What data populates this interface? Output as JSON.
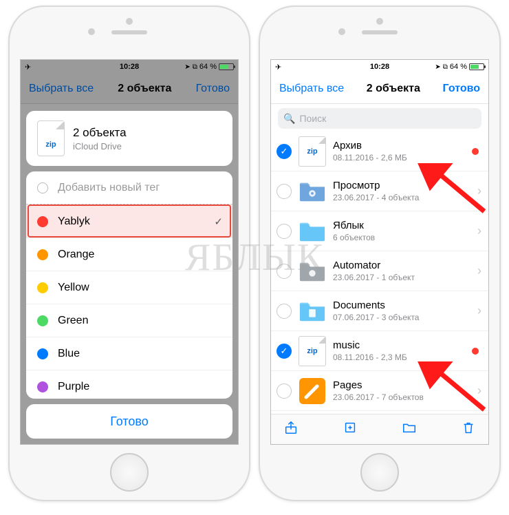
{
  "status": {
    "time": "10:28",
    "battery_text": "64 %"
  },
  "nav": {
    "select_all": "Выбрать все",
    "title": "2 объекта",
    "done": "Готово"
  },
  "sheet": {
    "icon_label": "zip",
    "title": "2 объекта",
    "subtitle": "iCloud Drive",
    "add_tag": "Добавить новый тег",
    "tags": [
      {
        "label": "Yablyk",
        "color": "#ff3b30",
        "selected": true
      },
      {
        "label": "Orange",
        "color": "#ff9500",
        "selected": false
      },
      {
        "label": "Yellow",
        "color": "#ffcc00",
        "selected": false
      },
      {
        "label": "Green",
        "color": "#4cd964",
        "selected": false
      },
      {
        "label": "Blue",
        "color": "#007aff",
        "selected": false
      },
      {
        "label": "Purple",
        "color": "#af52de",
        "selected": false
      }
    ],
    "done": "Готово"
  },
  "search": {
    "placeholder": "Поиск"
  },
  "files": [
    {
      "name": "Архив",
      "sub": "08.11.2016 - 2,6 МБ",
      "kind": "zip",
      "selected": true,
      "tagged": true
    },
    {
      "name": "Просмотр",
      "sub": "23.06.2017 - 4 объекта",
      "kind": "folder",
      "selected": false,
      "tagged": false,
      "color": "#6ea6dd",
      "glyph": "preview"
    },
    {
      "name": "Яблык",
      "sub": "6 объектов",
      "kind": "folder",
      "selected": false,
      "tagged": false,
      "color": "#65c6f7"
    },
    {
      "name": "Automator",
      "sub": "23.06.2017 - 1 объект",
      "kind": "folder",
      "selected": false,
      "tagged": false,
      "color": "#9fa6ac",
      "glyph": "robot"
    },
    {
      "name": "Documents",
      "sub": "07.06.2017 - 3 объекта",
      "kind": "folder",
      "selected": false,
      "tagged": false,
      "color": "#65c6f7",
      "glyph": "doc"
    },
    {
      "name": "music",
      "sub": "08.11.2016 - 2,3 МБ",
      "kind": "zip",
      "selected": true,
      "tagged": true
    },
    {
      "name": "Pages",
      "sub": "23.06.2017 - 7 объектов",
      "kind": "pages",
      "selected": false,
      "tagged": false
    }
  ],
  "watermark": "ЯБЛЫК"
}
